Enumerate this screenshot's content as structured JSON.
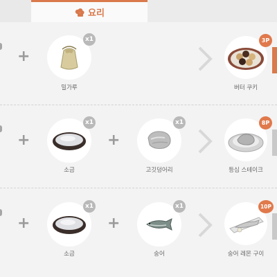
{
  "tab": {
    "label": "요리",
    "icon": "chef-icon"
  },
  "recipes": [
    {
      "ingredients": [
        {
          "name": "밀가루",
          "qty": "x1",
          "icon": "flour-sack-icon"
        }
      ],
      "result": {
        "name": "버터 쿠키",
        "points": "3P",
        "icon": "butter-cookie-plate-icon"
      }
    },
    {
      "ingredients": [
        {
          "name": "소금",
          "qty": "x1",
          "icon": "salt-bowl-icon"
        },
        {
          "name": "고깃덩어리",
          "qty": "x1",
          "icon": "meat-chunk-icon"
        }
      ],
      "result": {
        "name": "등심 스테이크",
        "points": "8P",
        "icon": "steak-plate-icon"
      }
    },
    {
      "ingredients": [
        {
          "name": "소금",
          "qty": "x1",
          "icon": "salt-bowl-icon"
        },
        {
          "name": "숭어",
          "qty": "x1",
          "icon": "mullet-fish-icon"
        }
      ],
      "result": {
        "name": "숭어 레몬 구이",
        "points": "10P",
        "icon": "grilled-fish-plate-icon"
      }
    }
  ],
  "colors": {
    "accent": "#d9794c",
    "badge_qty": "#b9b9b9",
    "side_tab_active": "#d9794c"
  }
}
